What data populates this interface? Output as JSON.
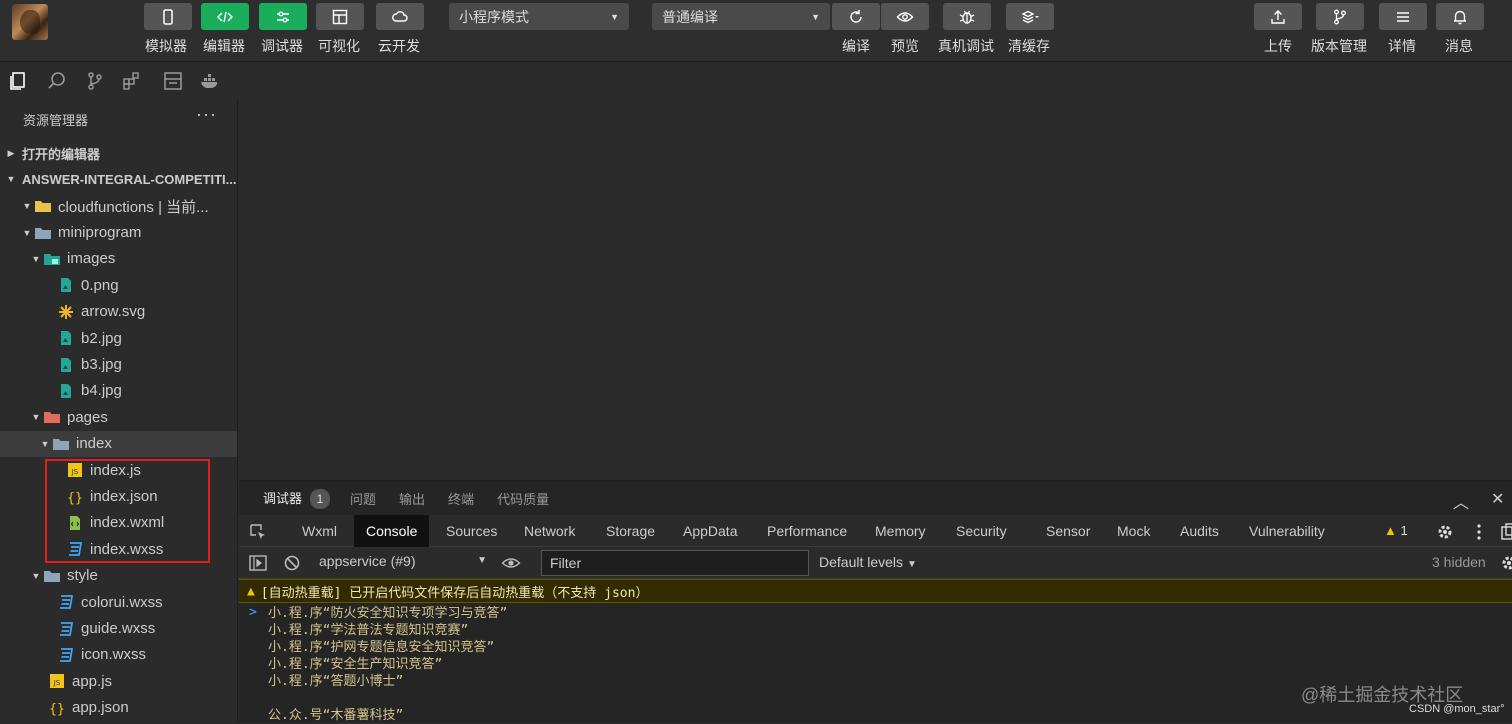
{
  "toolbar": {
    "left_buttons": [
      {
        "label": "模拟器",
        "icon": "phone-icon"
      },
      {
        "label": "编辑器",
        "icon": "code-icon"
      },
      {
        "label": "调试器",
        "icon": "debug-sliders-icon"
      },
      {
        "label": "可视化",
        "icon": "layout-icon"
      },
      {
        "label": "云开发",
        "icon": "cloud-icon"
      }
    ],
    "mode_select": "小程序模式",
    "compile_select": "普通编译",
    "center_buttons": [
      {
        "label": "编译",
        "icon": "refresh-icon"
      },
      {
        "label": "预览",
        "icon": "eye-icon"
      },
      {
        "label": "真机调试",
        "icon": "bug-icon"
      },
      {
        "label": "清缓存",
        "icon": "layers-icon"
      }
    ],
    "right_buttons": [
      {
        "label": "上传",
        "icon": "upload-icon"
      },
      {
        "label": "版本管理",
        "icon": "branch-icon"
      },
      {
        "label": "详情",
        "icon": "menu-icon"
      },
      {
        "label": "消息",
        "icon": "bell-icon"
      }
    ]
  },
  "sidebar": {
    "title": "资源管理器",
    "more": "···",
    "open_editors": "打开的编辑器",
    "project": "ANSWER-INTEGRAL-COMPETITI...",
    "tree": [
      {
        "name": "cloudfunctions | 当前...",
        "type": "folder-cloud"
      },
      {
        "name": "miniprogram",
        "type": "folder"
      },
      {
        "name": "images",
        "type": "folder-images"
      },
      {
        "name": "0.png",
        "type": "image"
      },
      {
        "name": "arrow.svg",
        "type": "svg"
      },
      {
        "name": "b2.jpg",
        "type": "image"
      },
      {
        "name": "b3.jpg",
        "type": "image"
      },
      {
        "name": "b4.jpg",
        "type": "image"
      },
      {
        "name": "pages",
        "type": "folder-pages"
      },
      {
        "name": "index",
        "type": "folder"
      },
      {
        "name": "index.js",
        "type": "js"
      },
      {
        "name": "index.json",
        "type": "json"
      },
      {
        "name": "index.wxml",
        "type": "wxml"
      },
      {
        "name": "index.wxss",
        "type": "wxss"
      },
      {
        "name": "style",
        "type": "folder"
      },
      {
        "name": "colorui.wxss",
        "type": "wxss"
      },
      {
        "name": "guide.wxss",
        "type": "wxss"
      },
      {
        "name": "icon.wxss",
        "type": "wxss"
      },
      {
        "name": "app.js",
        "type": "js"
      },
      {
        "name": "app.json",
        "type": "json"
      }
    ]
  },
  "debug": {
    "tabs": [
      "调试器",
      "问题",
      "输出",
      "终端",
      "代码质量"
    ],
    "badge": "1",
    "devtools_tabs": [
      "Wxml",
      "Console",
      "Sources",
      "Network",
      "Storage",
      "AppData",
      "Performance",
      "Memory",
      "Security",
      "Sensor",
      "Mock",
      "Audits",
      "Vulnerability"
    ],
    "active_devtools_tab": "Console",
    "warning_count": "1",
    "context": "appservice (#9)",
    "filter_placeholder": "Filter",
    "levels": "Default levels",
    "hidden": "3 hidden",
    "warning_message": "[自动热重载] 已开启代码文件保存后自动热重载（不支持 json）",
    "logs": [
      "小.程.序“防火安全知识专项学习与竞答”",
      "小.程.序“学法普法专题知识竞赛”",
      "小.程.序“护网专题信息安全知识竞答”",
      "小.程.序“安全生产知识竞答”",
      "小.程.序“答题小博士”",
      "",
      "公.众.号“木番薯科技”"
    ],
    "watermark": "@稀土掘金技术社区",
    "csdn": "CSDN @mon_star°"
  },
  "colors": {
    "accent_green": "#1aad5c",
    "warning_bg": "#332b00",
    "highlight_red": "#e02020"
  }
}
